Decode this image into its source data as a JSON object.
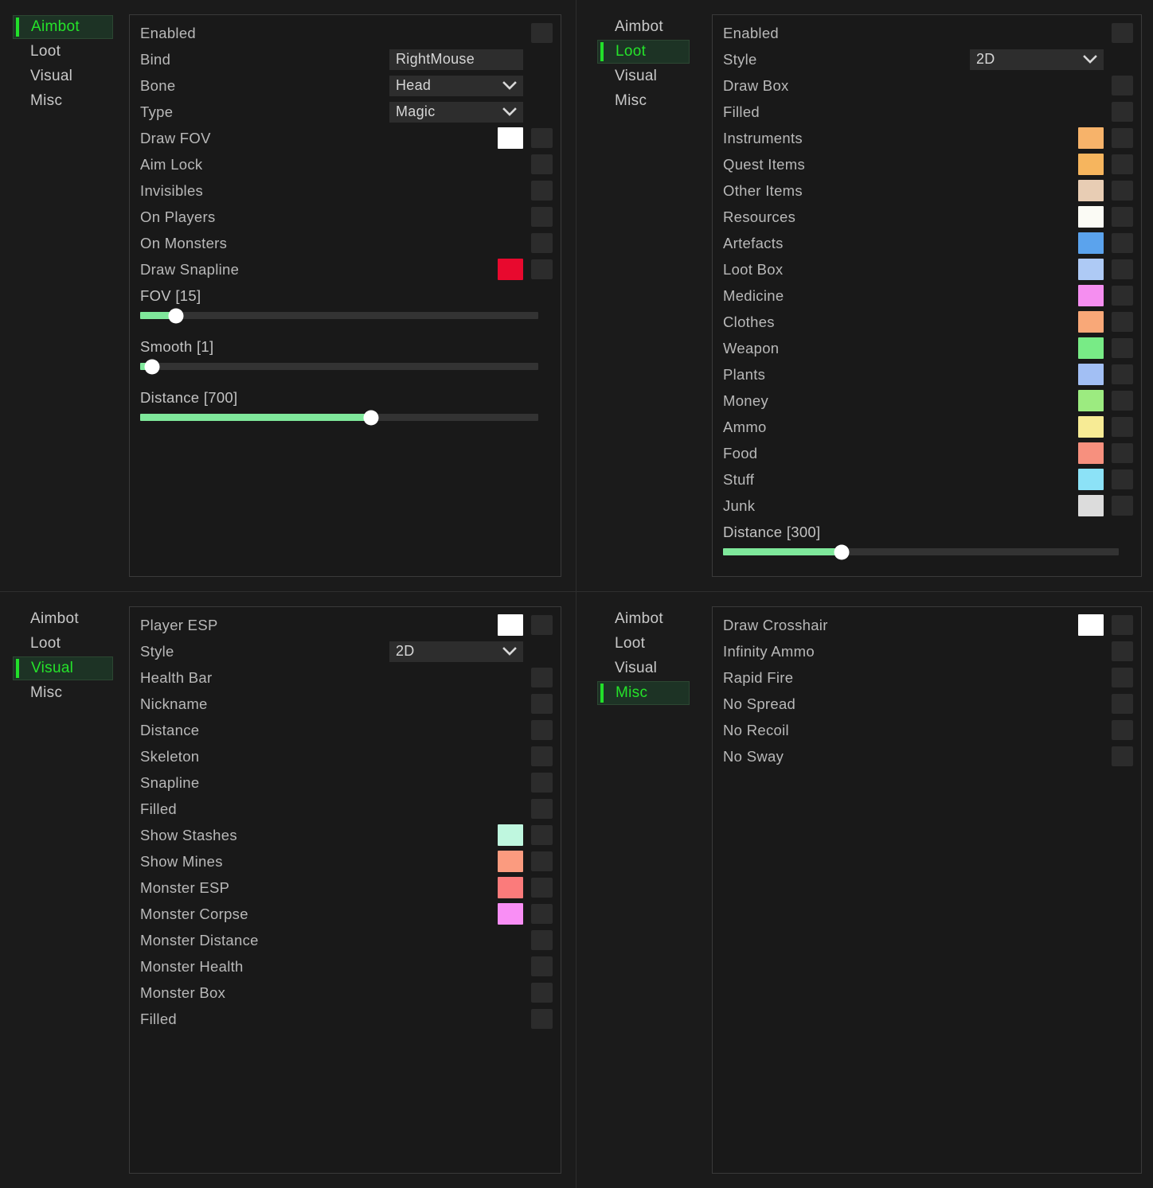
{
  "nav": {
    "tabs": [
      "Aimbot",
      "Loot",
      "Visual",
      "Misc"
    ]
  },
  "colors": {
    "accent_green": "#22e02a",
    "slider_fill": "#7fe89b",
    "knob": "#ffffff",
    "toggle_off": "#2c2c2c",
    "panel_bg": "#191919",
    "panel_border": "#3a3a3a",
    "label": "#b9b9b9",
    "field_bg": "#2d2d2d",
    "active_tab_bg": "#1d3325"
  },
  "panels": [
    {
      "id": "aimbot",
      "active_tab": "Aimbot",
      "rows": [
        {
          "label": "Enabled",
          "type": "toggle"
        },
        {
          "label": "Bind",
          "type": "field",
          "value": "RightMouse",
          "dropdown": false
        },
        {
          "label": "Bone",
          "type": "field",
          "value": "Head",
          "dropdown": true
        },
        {
          "label": "Type",
          "type": "field",
          "value": "Magic",
          "dropdown": true
        },
        {
          "label": "Draw FOV",
          "type": "toggle",
          "swatch": "#ffffff"
        },
        {
          "label": "Aim Lock",
          "type": "toggle"
        },
        {
          "label": "Invisibles",
          "type": "toggle"
        },
        {
          "label": "On Players",
          "type": "toggle"
        },
        {
          "label": "On Monsters",
          "type": "toggle"
        },
        {
          "label": "Draw Snapline",
          "type": "toggle",
          "swatch": "#e8092e"
        }
      ],
      "sliders": [
        {
          "label": "FOV [15]",
          "percent": 9
        },
        {
          "label": "Smooth [1]",
          "percent": 3
        },
        {
          "label": "Distance [700]",
          "percent": 58
        }
      ]
    },
    {
      "id": "loot",
      "active_tab": "Loot",
      "rows": [
        {
          "label": "Enabled",
          "type": "toggle"
        },
        {
          "label": "Style",
          "type": "field",
          "value": "2D",
          "dropdown": true
        },
        {
          "label": "Draw Box",
          "type": "toggle"
        },
        {
          "label": "Filled",
          "type": "toggle"
        },
        {
          "label": "Instruments",
          "type": "toggle",
          "swatch": "#f7b36a"
        },
        {
          "label": "Quest Items",
          "type": "toggle",
          "swatch": "#f6b55e"
        },
        {
          "label": "Other Items",
          "type": "toggle",
          "swatch": "#e8cdb4"
        },
        {
          "label": "Resources",
          "type": "toggle",
          "swatch": "#fbfbf5"
        },
        {
          "label": "Artefacts",
          "type": "toggle",
          "swatch": "#5ba3ed"
        },
        {
          "label": "Loot Box",
          "type": "toggle",
          "swatch": "#aecaf5"
        },
        {
          "label": "Medicine",
          "type": "toggle",
          "swatch": "#f58ef0"
        },
        {
          "label": "Clothes",
          "type": "toggle",
          "swatch": "#f9a878"
        },
        {
          "label": "Weapon",
          "type": "toggle",
          "swatch": "#78eb86"
        },
        {
          "label": "Plants",
          "type": "toggle",
          "swatch": "#a2bff4"
        },
        {
          "label": "Money",
          "type": "toggle",
          "swatch": "#9ceb80"
        },
        {
          "label": "Ammo",
          "type": "toggle",
          "swatch": "#f7eb95"
        },
        {
          "label": "Food",
          "type": "toggle",
          "swatch": "#f7907e"
        },
        {
          "label": "Stuff",
          "type": "toggle",
          "swatch": "#8ce2f7"
        },
        {
          "label": "Junk",
          "type": "toggle",
          "swatch": "#dcdcdc"
        }
      ],
      "sliders": [
        {
          "label": "Distance [300]",
          "percent": 30
        }
      ]
    },
    {
      "id": "visual",
      "active_tab": "Visual",
      "rows": [
        {
          "label": "Player ESP",
          "type": "toggle",
          "swatch": "#ffffff"
        },
        {
          "label": "Style",
          "type": "field",
          "value": "2D",
          "dropdown": true
        },
        {
          "label": "Health Bar",
          "type": "toggle"
        },
        {
          "label": "Nickname",
          "type": "toggle"
        },
        {
          "label": "Distance",
          "type": "toggle"
        },
        {
          "label": "Skeleton",
          "type": "toggle"
        },
        {
          "label": "Snapline",
          "type": "toggle"
        },
        {
          "label": "Filled",
          "type": "toggle"
        },
        {
          "label": "Show Stashes",
          "type": "toggle",
          "swatch": "#bff7df"
        },
        {
          "label": "Show Mines",
          "type": "toggle",
          "swatch": "#fb9b7f"
        },
        {
          "label": "Monster ESP",
          "type": "toggle",
          "swatch": "#fb7b7b"
        },
        {
          "label": "Monster Corpse",
          "type": "toggle",
          "swatch": "#f98ef5"
        },
        {
          "label": "Monster Distance",
          "type": "toggle"
        },
        {
          "label": "Monster Health",
          "type": "toggle"
        },
        {
          "label": "Monster Box",
          "type": "toggle"
        },
        {
          "label": "Filled",
          "type": "toggle"
        }
      ],
      "sliders": []
    },
    {
      "id": "misc",
      "active_tab": "Misc",
      "rows": [
        {
          "label": "Draw Crosshair",
          "type": "toggle",
          "swatch": "#ffffff"
        },
        {
          "label": "Infinity Ammo",
          "type": "toggle"
        },
        {
          "label": "Rapid Fire",
          "type": "toggle"
        },
        {
          "label": "No Spread",
          "type": "toggle"
        },
        {
          "label": "No Recoil",
          "type": "toggle"
        },
        {
          "label": "No Sway",
          "type": "toggle"
        }
      ],
      "sliders": []
    }
  ]
}
